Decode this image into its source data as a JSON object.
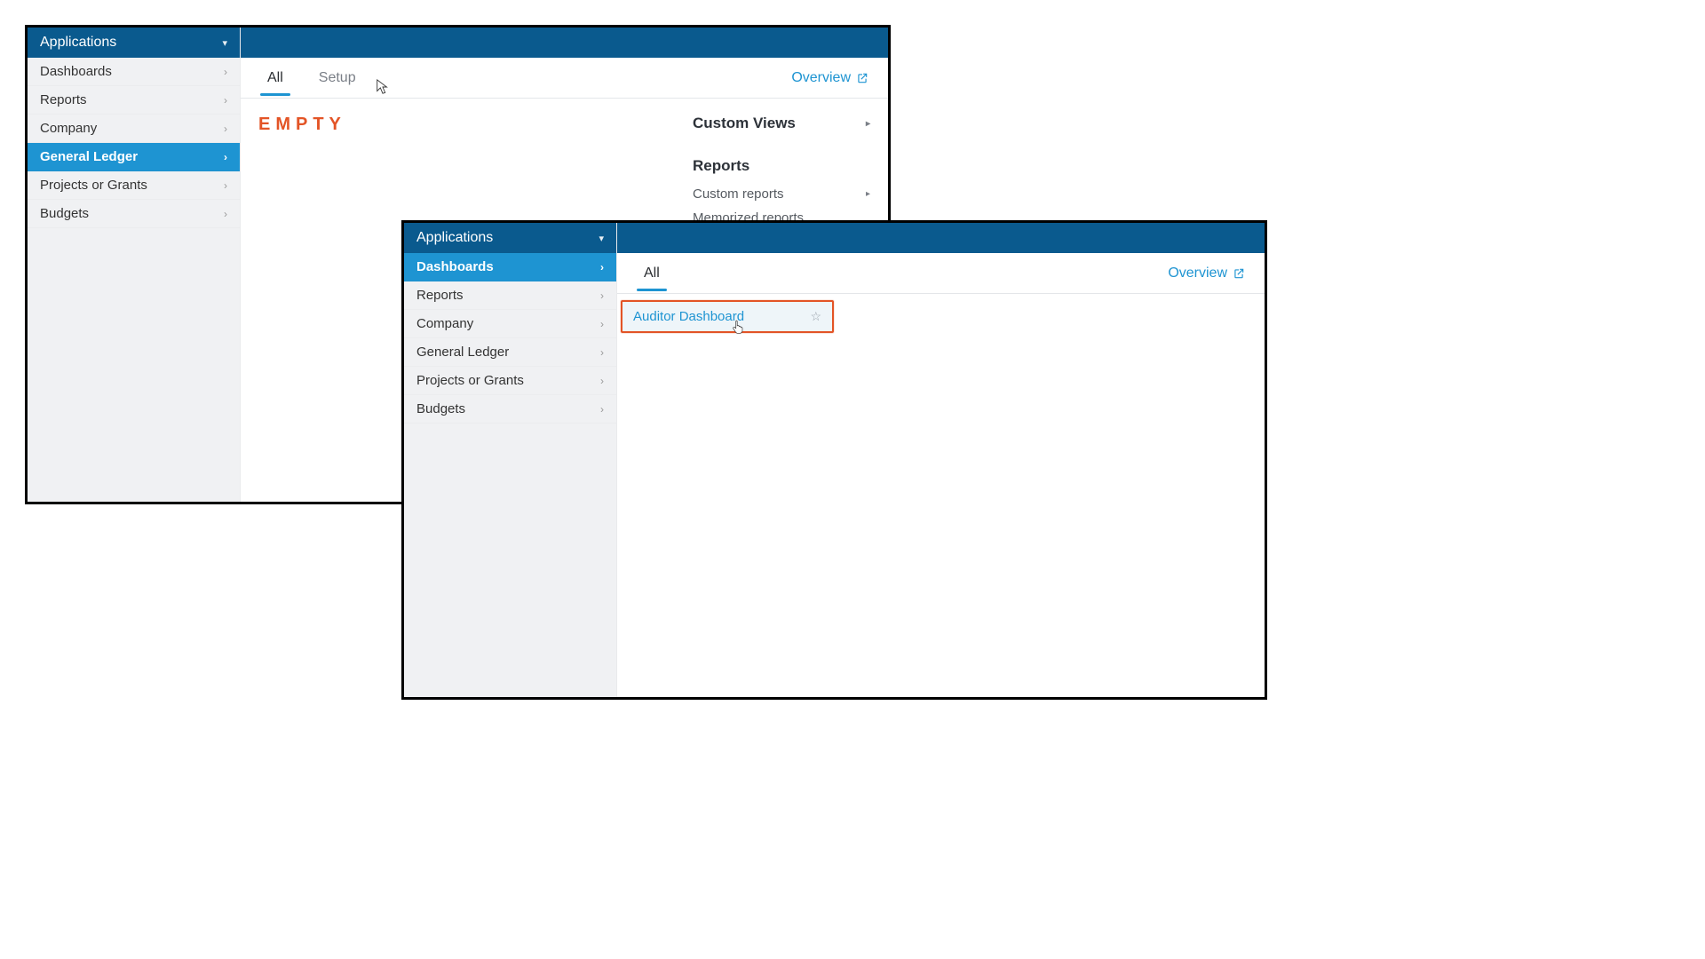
{
  "windowA": {
    "sidebar": {
      "header": "Applications",
      "items": [
        {
          "label": "Dashboards",
          "active": false
        },
        {
          "label": "Reports",
          "active": false
        },
        {
          "label": "Company",
          "active": false
        },
        {
          "label": "General Ledger",
          "active": true
        },
        {
          "label": "Projects or Grants",
          "active": false
        },
        {
          "label": "Budgets",
          "active": false
        }
      ]
    },
    "tabs": {
      "all": "All",
      "setup": "Setup"
    },
    "overview": "Overview",
    "empty": "EMPTY",
    "right": {
      "customViews": "Custom Views",
      "reportsHeader": "Reports",
      "customReports": "Custom reports",
      "memorizedReports": "Memorized reports"
    }
  },
  "windowB": {
    "sidebar": {
      "header": "Applications",
      "items": [
        {
          "label": "Dashboards",
          "active": true
        },
        {
          "label": "Reports",
          "active": false
        },
        {
          "label": "Company",
          "active": false
        },
        {
          "label": "General Ledger",
          "active": false
        },
        {
          "label": "Projects or Grants",
          "active": false
        },
        {
          "label": "Budgets",
          "active": false
        }
      ]
    },
    "tabs": {
      "all": "All"
    },
    "overview": "Overview",
    "highlightItem": "Auditor Dashboard"
  }
}
